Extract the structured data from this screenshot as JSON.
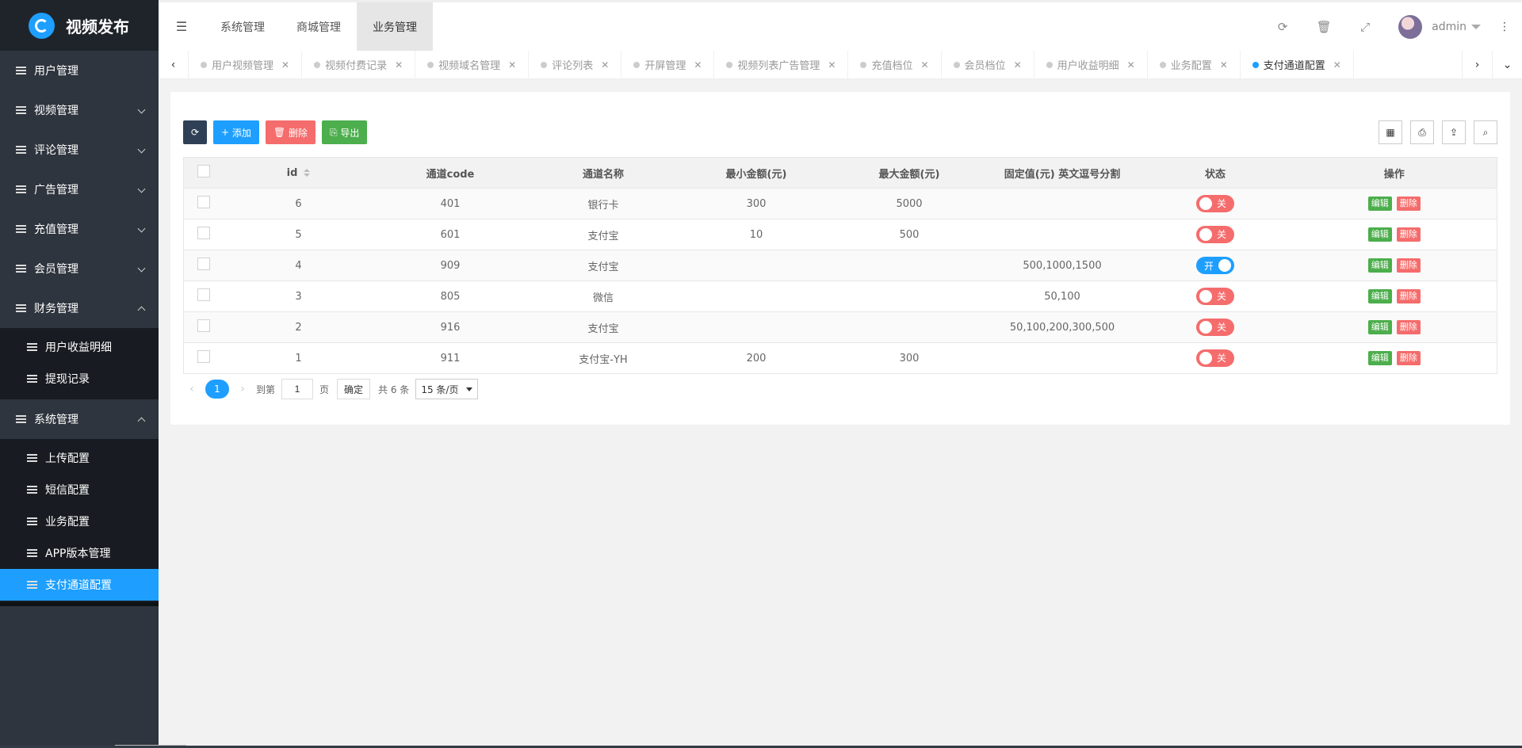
{
  "app": {
    "title": "视频发布"
  },
  "sidebar": {
    "items": [
      {
        "label": "用户管理",
        "arrow": ""
      },
      {
        "label": "视频管理",
        "arrow": "down"
      },
      {
        "label": "评论管理",
        "arrow": "down"
      },
      {
        "label": "广告管理",
        "arrow": "down"
      },
      {
        "label": "充值管理",
        "arrow": "down"
      },
      {
        "label": "会员管理",
        "arrow": "down"
      },
      {
        "label": "财务管理",
        "arrow": "up"
      }
    ],
    "finance_sub": [
      "用户收益明细",
      "提现记录"
    ],
    "system": {
      "label": "系统管理"
    },
    "system_sub": [
      "上传配置",
      "短信配置",
      "业务配置",
      "APP版本管理",
      "支付通道配置"
    ]
  },
  "header": {
    "tabs": [
      "系统管理",
      "商城管理",
      "业务管理"
    ],
    "active_tab": "业务管理",
    "user": "admin"
  },
  "page_tabs": [
    "用户视频管理",
    "视频付费记录",
    "视频域名管理",
    "评论列表",
    "开屏管理",
    "视频列表广告管理",
    "充值档位",
    "会员档位",
    "用户收益明细",
    "业务配置",
    "支付通道配置"
  ],
  "toolbar": {
    "add": "添加",
    "delete": "删除",
    "export": "导出"
  },
  "table": {
    "columns": [
      "id",
      "通道code",
      "通道名称",
      "最小金额(元)",
      "最大金额(元)",
      "固定值(元) 英文逗号分割",
      "状态",
      "操作"
    ],
    "rows": [
      {
        "id": "6",
        "code": "401",
        "name": "银行卡",
        "min": "300",
        "max": "5000",
        "fixed": "",
        "status": "关",
        "on": false
      },
      {
        "id": "5",
        "code": "601",
        "name": "支付宝",
        "min": "10",
        "max": "500",
        "fixed": "",
        "status": "关",
        "on": false
      },
      {
        "id": "4",
        "code": "909",
        "name": "支付宝",
        "min": "",
        "max": "",
        "fixed": "500,1000,1500",
        "status": "开",
        "on": true
      },
      {
        "id": "3",
        "code": "805",
        "name": "微信",
        "min": "",
        "max": "",
        "fixed": "50,100",
        "status": "关",
        "on": false
      },
      {
        "id": "2",
        "code": "916",
        "name": "支付宝",
        "min": "",
        "max": "",
        "fixed": "50,100,200,300,500",
        "status": "关",
        "on": false
      },
      {
        "id": "1",
        "code": "911",
        "name": "支付宝-YH",
        "min": "200",
        "max": "300",
        "fixed": "",
        "status": "关",
        "on": false
      }
    ],
    "edit_label": "编辑",
    "delete_label": "删除"
  },
  "pager": {
    "current": "1",
    "goto_prefix": "到第",
    "goto_value": "1",
    "goto_suffix": "页",
    "confirm": "确定",
    "total": "共 6 条",
    "per_page": "15 条/页"
  },
  "colors": {
    "accent": "#1e9fff",
    "danger": "#f56c6c",
    "success": "#4cae4c",
    "sidebar": "#2f353e"
  }
}
